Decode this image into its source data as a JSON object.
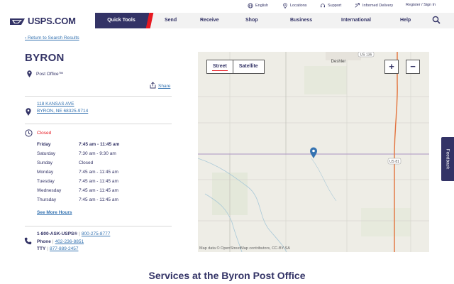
{
  "utility": {
    "language": "English",
    "locations": "Locations",
    "support": "Support",
    "informed_delivery": "Informed Delivery",
    "register": "Register / Sign In"
  },
  "nav": {
    "logo": "USPS.COM",
    "quick_tools": "Quick Tools",
    "send": "Send",
    "receive": "Receive",
    "shop": "Shop",
    "business": "Business",
    "international": "International",
    "help": "Help"
  },
  "location": {
    "back_link": "Return to Search Results",
    "title": "BYRON",
    "type": "Post Office™",
    "share": "Share",
    "address_line1": "118 KANSAS AVE",
    "address_line2": "BYRON, NE 68325-9714",
    "status": "Closed",
    "hours": [
      {
        "day": "Friday",
        "time": "7:45 am - 11:45 am"
      },
      {
        "day": "Saturday",
        "time": "7:30 am - 9:30 am"
      },
      {
        "day": "Sunday",
        "time": "Closed"
      },
      {
        "day": "Monday",
        "time": "7:45 am - 11:45 am"
      },
      {
        "day": "Tuesday",
        "time": "7:45 am - 11:45 am"
      },
      {
        "day": "Wednesday",
        "time": "7:45 am - 11:45 am"
      },
      {
        "day": "Thursday",
        "time": "7:45 am - 11:45 am"
      }
    ],
    "see_more_hours": "See More Hours",
    "contact": {
      "ask_usps": "1-800-ASK-USPS®",
      "ask_usps_number": "800-275-8777",
      "phone_label": "Phone",
      "phone": "402-236-8851",
      "tty_label": "TTY",
      "tty": "877-889-2457"
    }
  },
  "map": {
    "street": "Street",
    "satellite": "Satellite",
    "zoom_in": "+",
    "zoom_out": "−",
    "place_label": "Deshler",
    "road_label_top": "US 136",
    "road_label_right": "US 81",
    "attribution": "Map data © OpenStreetMap contributors, CC-BY-SA"
  },
  "services_heading": "Services at the Byron Post Office",
  "feedback": "Feedback",
  "colors": {
    "navy": "#333366",
    "red": "#e71921",
    "link": "#3573b1"
  }
}
